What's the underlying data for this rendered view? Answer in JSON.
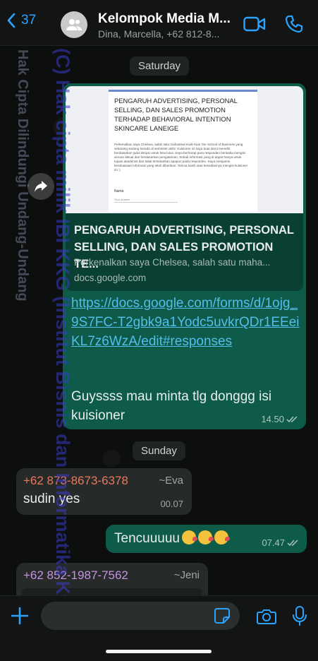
{
  "header": {
    "back_count": "37",
    "title": "Kelompok Media M...",
    "subtitle": "Dina, Marcella, +62 812-8..."
  },
  "dates": {
    "saturday": "Saturday",
    "sunday": "Sunday"
  },
  "link_preview": {
    "image_title": "PENGARUH ADVERTISING, PERSONAL SELLING, DAN SALES PROMOTION TERHADAP BEHAVIORAL INTENTION SKINCARE LANEIGE",
    "image_desc": "Perkenalkan saya Chelsea, salah satu mahasiswi Kwik Kian Gie School of Business yang sekarang sedang berada di semester akhir. Kuisioner ini saya buat demi meneliti berdasarkan judul skripsi untuk bisa lulus. Saya berharap para responden bersedia mengisi secara aktual dan berdasarkan pengalaman. Sebab informasi yang di dapat hanya untuk tujuan akademis dan tidak tersebarkan apapun pada responden. Saya menjamin kerahasiaan informasi yang telah diberikan. Terima kasih atas kesediannya mengisi kuisioner ini :)",
    "image_name_label": "Nama",
    "image_answer_label": "Your answer",
    "title": "PENGARUH ADVERTISING, PERSONAL SELLING, DAN SALES PROMOTION TE...",
    "description": "Perkenalkan saya Chelsea, salah satu maha...",
    "domain": "docs.google.com"
  },
  "messages": {
    "main_url": "https://docs.google.com/forms/d/1ojg_9S7FC-T2gbk9a1Yodc5uvkrQDr1EEeiKL7z6WzA/edit#responses",
    "main_text": "Guyssss mau minta tlg donggg isi kuisioner",
    "main_time": "14.50",
    "eva_number": "+62 873-8673-6378",
    "eva_tag": "~Eva",
    "eva_text": "sudin yes",
    "eva_time": "00.07",
    "tencu_text": "Tencuuuuu",
    "tencu_time": "07.47",
    "jeni_number": "+62 852-1987-7562",
    "jeni_tag": "~Jeni"
  },
  "watermark": {
    "main": "(C) Hak cipta milik IBI KKG (Institut Bisnis dan Informatika Kwik",
    "secondary": "Hak Cipta Dilindungi Undang-Undang"
  },
  "colors": {
    "accent_blue": "#2aa4ff",
    "outgoing_bubble": "#0d5b48",
    "incoming_bubble": "#262a29",
    "link_blue": "#53bdeb",
    "eva_name": "#e8785e",
    "jeni_name": "#c792e0"
  }
}
